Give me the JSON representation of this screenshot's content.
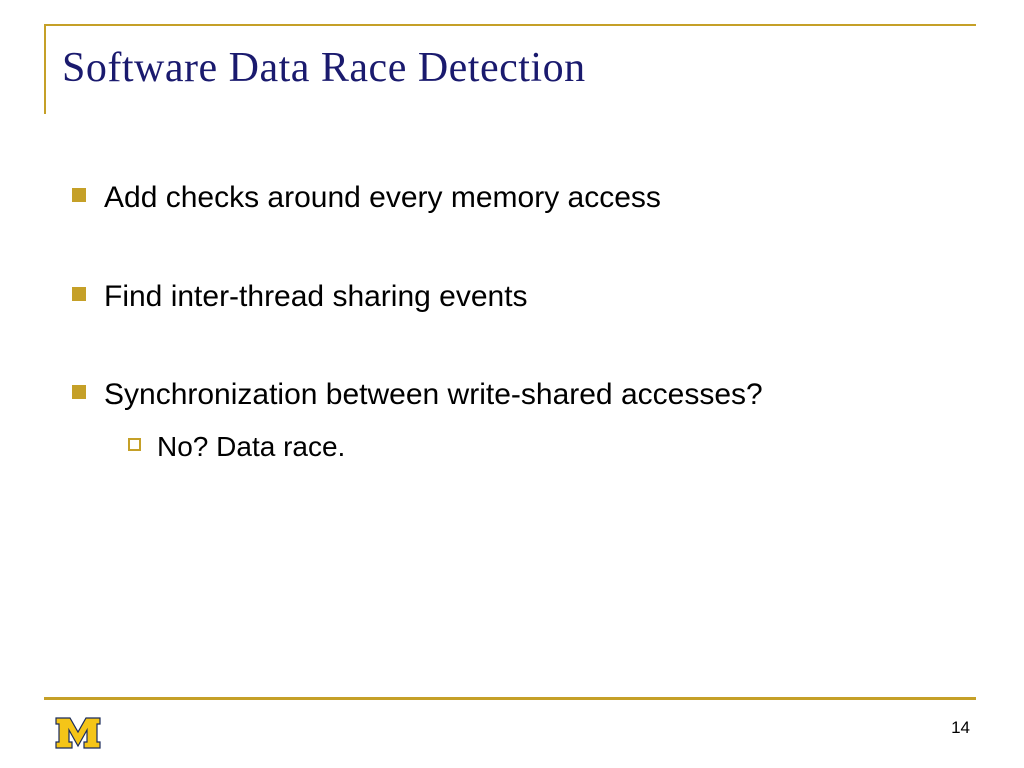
{
  "title": "Software Data Race Detection",
  "bullets": [
    {
      "text": "Add checks around every memory access"
    },
    {
      "text": "Find inter-thread sharing events"
    },
    {
      "text": "Synchronization between write-shared accesses?"
    }
  ],
  "sub_bullets": [
    {
      "text": "No? Data race."
    }
  ],
  "page_number": "14",
  "colors": {
    "accent": "#c5a028",
    "title": "#1a1a6e"
  }
}
